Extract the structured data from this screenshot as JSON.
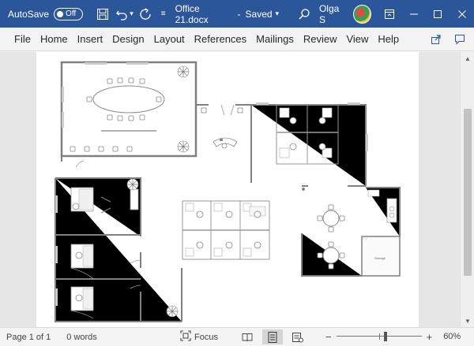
{
  "titlebar": {
    "autosave_label": "AutoSave",
    "autosave_state": "Off",
    "doc_title": "Office 21.docx",
    "save_status": "Saved",
    "user_name": "Olga S",
    "icons": [
      "save-icon",
      "undo-icon",
      "redo-icon",
      "customize-icon",
      "search-icon",
      "ribbon-display-icon",
      "minimize-icon",
      "maximize-icon",
      "close-icon"
    ]
  },
  "ribbon": {
    "tabs": [
      "File",
      "Home",
      "Insert",
      "Design",
      "Layout",
      "References",
      "Mailings",
      "Review",
      "View",
      "Help"
    ]
  },
  "statusbar": {
    "page": "Page 1 of 1",
    "words": "0 words",
    "focus": "Focus",
    "zoom_minus": "−",
    "zoom_plus": "+",
    "zoom": "60%"
  },
  "floorplan": {
    "storage_label": "Storage"
  },
  "colors": {
    "titlebar": "#2b579a",
    "wall": "#808080"
  }
}
